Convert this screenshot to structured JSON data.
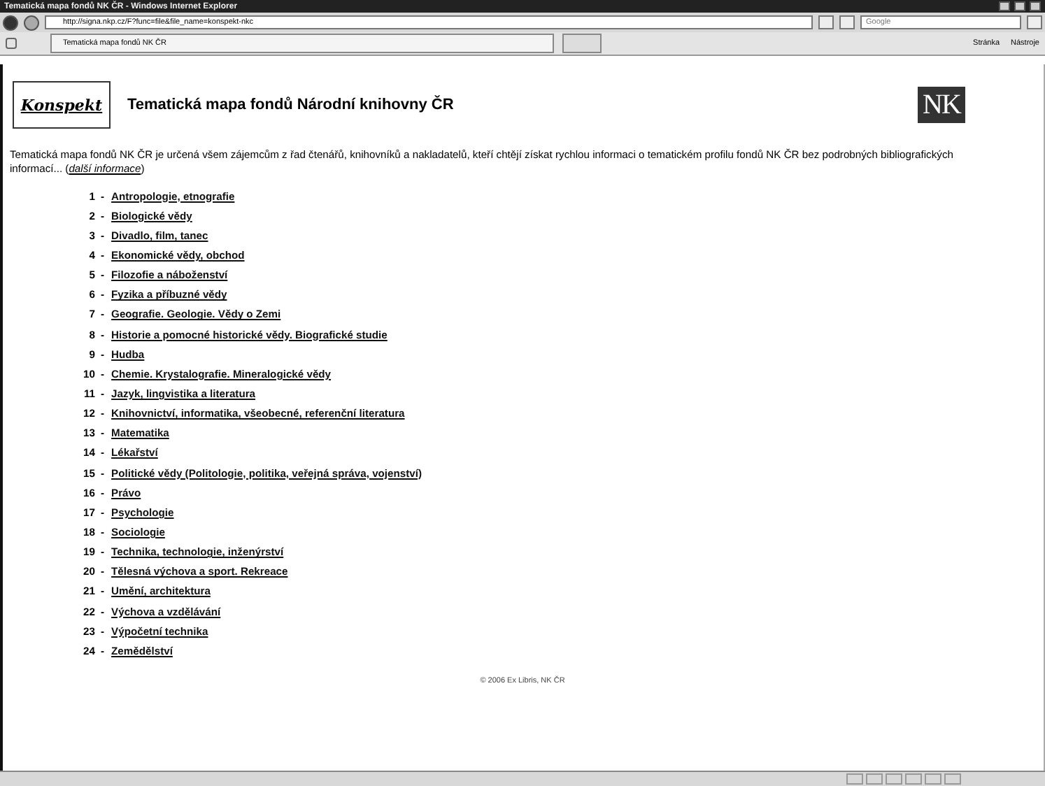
{
  "window": {
    "title": "Tematická mapa fondů NK ČR - Windows Internet Explorer"
  },
  "address_bar": {
    "url": "http://signa.nkp.cz/F?func=file&file_name=konspekt-nkc",
    "search_placeholder": "Google"
  },
  "tabs": [
    {
      "label": "Tematická mapa fondů NK ČR",
      "selected": true
    }
  ],
  "command_bar": {
    "items": [
      "Stránka",
      "Nástroje"
    ]
  },
  "page": {
    "logo_text": "Konspekt",
    "title": "Tematická mapa fondů Národní knihovny ČR",
    "nk_logo": "NK",
    "intro": "Tematická mapa fondů NK ČR je určená všem zájemcům z řad čtenářů, knihovníků a nakladatelů, kteří chtějí získat rychlou informaci o tematickém profilu fondů NK ČR bez podrobných bibliografických informací... (",
    "intro_link": "další informace",
    "intro_end": ")",
    "topics": [
      {
        "number": "1",
        "label": "Antropologie, etnografie"
      },
      {
        "number": "2",
        "label": "Biologické vědy"
      },
      {
        "number": "3",
        "label": "Divadlo, film, tanec"
      },
      {
        "number": "4",
        "label": "Ekonomické vědy, obchod"
      },
      {
        "number": "5",
        "label": "Filozofie a náboženství"
      },
      {
        "number": "6",
        "label": "Fyzika a příbuzné vědy"
      },
      {
        "number": "7",
        "label": "Geografie. Geologie. Vědy o Zemi"
      },
      {
        "number": "8",
        "label": "Historie a pomocné historické vědy. Biografické studie"
      },
      {
        "number": "9",
        "label": "Hudba"
      },
      {
        "number": "10",
        "label": "Chemie. Krystalografie. Mineralogické vědy"
      },
      {
        "number": "11",
        "label": "Jazyk, lingvistika a literatura"
      },
      {
        "number": "12",
        "label": "Knihovnictví, informatika, všeobecné, referenční literatura"
      },
      {
        "number": "13",
        "label": "Matematika"
      },
      {
        "number": "14",
        "label": "Lékařství"
      },
      {
        "number": "15",
        "label": "Politické vědy (Politologie, politika, veřejná správa, vojenství)"
      },
      {
        "number": "16",
        "label": "Právo"
      },
      {
        "number": "17",
        "label": "Psychologie"
      },
      {
        "number": "18",
        "label": "Sociologie"
      },
      {
        "number": "19",
        "label": "Technika, technologie, inženýrství"
      },
      {
        "number": "20",
        "label": "Tělesná výchova a sport. Rekreace"
      },
      {
        "number": "21",
        "label": "Umění, architektura"
      },
      {
        "number": "22",
        "label": "Výchova a vzdělávání"
      },
      {
        "number": "23",
        "label": "Výpočetní technika"
      },
      {
        "number": "24",
        "label": "Zemědělství"
      }
    ],
    "separator": "-",
    "footer": "© 2006 Ex Libris, NK ČR"
  }
}
